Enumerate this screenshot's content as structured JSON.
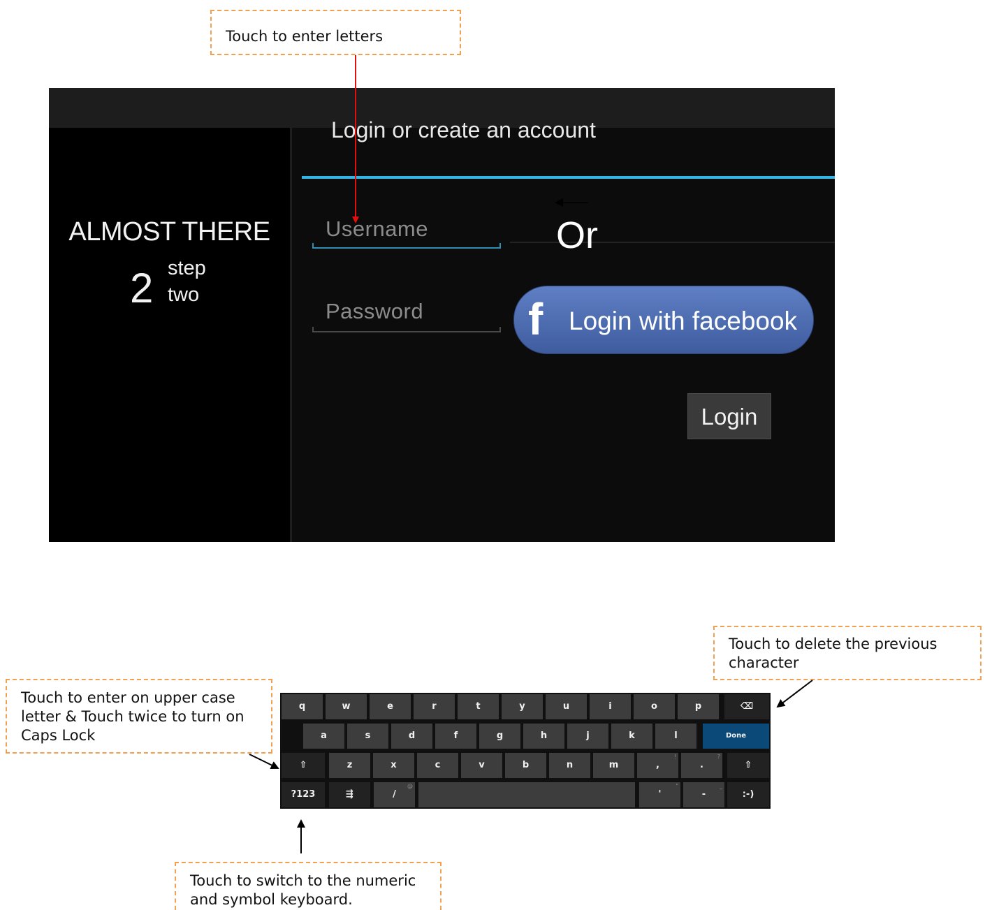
{
  "callouts": {
    "letters": "Touch to enter letters",
    "delete_line1": "Touch to delete the previous",
    "delete_line2": "character",
    "shift_line1": "Touch to enter on upper case",
    "shift_line2": "letter & Touch twice to turn on",
    "shift_line3": "Caps Lock",
    "numeric_line1": "Touch to switch to the numeric",
    "numeric_line2": "and symbol keyboard."
  },
  "side_panel": {
    "heading": "ALMOST THERE",
    "step_number": "2",
    "step_word1": "step",
    "step_word2": "two"
  },
  "dialog": {
    "title": "Login or create an account",
    "username_placeholder": "Username",
    "password_placeholder": "Password",
    "or_label": "Or",
    "facebook_icon": "f",
    "facebook_label": "Login with facebook",
    "login_label": "Login",
    "accent_color": "#33b5e5",
    "facebook_color": "#4c6baf"
  },
  "keyboard": {
    "row1": [
      "q",
      "w",
      "e",
      "r",
      "t",
      "y",
      "u",
      "i",
      "o",
      "p"
    ],
    "backspace_icon": "⌫",
    "row2": [
      "a",
      "s",
      "d",
      "f",
      "g",
      "h",
      "j",
      "k",
      "l"
    ],
    "done_label": "Done",
    "shift_icon": "⇧",
    "row3": [
      "z",
      "x",
      "c",
      "v",
      "b",
      "n",
      "m",
      ",",
      "."
    ],
    "row3_hints": [
      "",
      "",
      "",
      "",
      "",
      "",
      "",
      "!",
      "?"
    ],
    "symbols_label": "?123",
    "settings_icon": "⇶",
    "slash": "/",
    "slash_hint": "@",
    "apostrophe": "'",
    "apostrophe_hint": "\"",
    "dash": "-",
    "dash_hint": "_",
    "smiley": ":-)"
  }
}
